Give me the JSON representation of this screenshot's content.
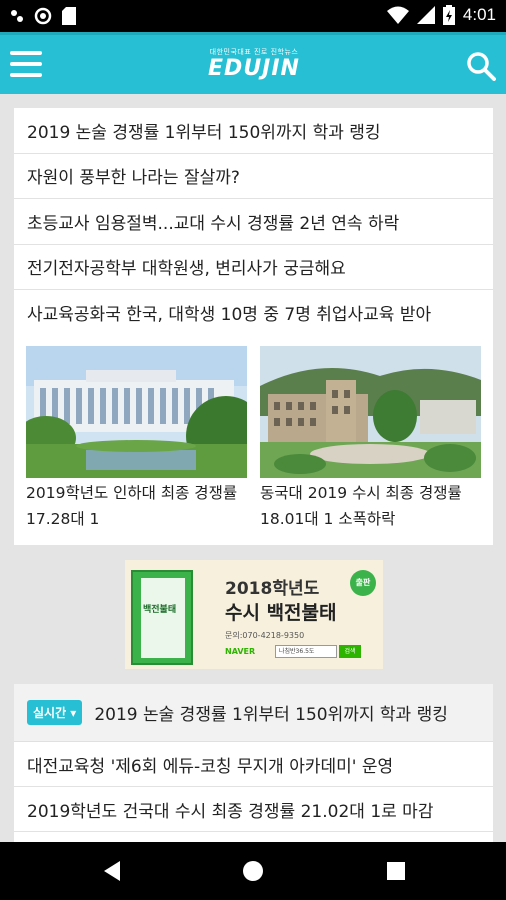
{
  "status_bar": {
    "time": "4:01",
    "icons": [
      "notification-dot-icon",
      "circle-icon",
      "sd-card-icon",
      "wifi-icon",
      "signal-icon",
      "battery-icon"
    ]
  },
  "app_bar": {
    "logo_tagline": "대한민국대표 진로 진학뉴스",
    "logo_text": "EDUJIN",
    "accent_color": "#27bfd3"
  },
  "headlines": [
    "2019 논술 경쟁률 1위부터 150위까지 학과 랭킹",
    "자원이 풍부한 나라는 잘살까?",
    "초등교사 임용절벽...교대 수시 경쟁률 2년 연속 하락",
    "전기전자공학부 대학원생, 변리사가 궁금해요",
    "사교육공화국 한국, 대학생 10명 중 7명 취업사교육 받아"
  ],
  "thumbnails": [
    {
      "caption": "2019학년도 인하대 최종 경쟁률 17.28대 1"
    },
    {
      "caption": "동국대 2019 수시 최종 경쟁률 18.01대 1 소폭하락"
    }
  ],
  "ad": {
    "book_title": "백전불태",
    "line1": "2018학년도",
    "line2": "수시 백전불태",
    "inquiry": "문의:070-4218-9350",
    "naver": "NAVER",
    "search_text": "나침반36.5도",
    "search_button": "검색",
    "badge": "출판"
  },
  "realtime": {
    "tag": "실시간",
    "headline": "2019 논술 경쟁률 1위부터 150위까지 학과 랭킹",
    "items": [
      "대전교육청 '제6회 에듀-코칭 무지개 아카데미' 운영",
      "2019학년도 건국대 수시 최종 경쟁률 21.02대 1로 마감"
    ]
  }
}
